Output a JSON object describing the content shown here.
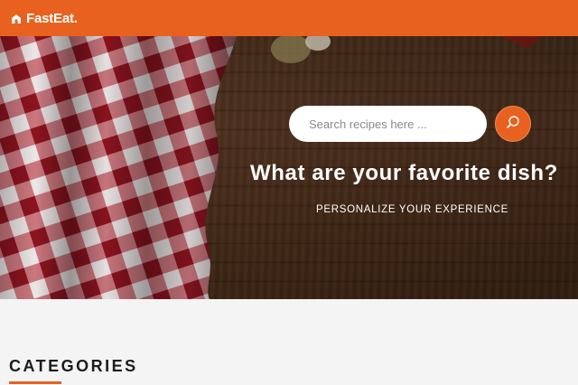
{
  "header": {
    "brand_name": "FastEat.",
    "brand_icon": "home-icon",
    "bg_color": "#e8611f"
  },
  "hero": {
    "search": {
      "placeholder": "Search recipes here ...",
      "value": "",
      "button_icon": "search-icon"
    },
    "title": "What are your favorite dish?",
    "subtitle": "PERSONALIZE YOUR EXPERIENCE"
  },
  "categories": {
    "heading": "CATEGORIES",
    "accent_color": "#e8611f"
  }
}
